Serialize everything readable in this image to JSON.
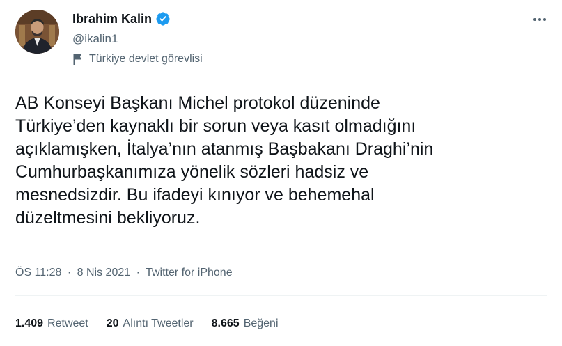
{
  "author": {
    "display_name": "Ibrahim Kalin",
    "handle": "@ikalin1",
    "label": "Türkiye devlet görevlisi",
    "verified_color": "#1d9bf0"
  },
  "tweet": {
    "text": "AB Konseyi Başkanı Michel protokol düzeninde\nTürkiye’den kaynaklı bir sorun veya kasıt olmadığını\naçıklamışken, İtalya’nın atanmış Başbakanı Draghi’nin\nCumhurbaşkanımıza yönelik sözleri hadsiz ve\nmesnedsizdir. Bu ifadeyi kınıyor ve behemehal\ndüzeltmesini bekliyoruz.",
    "time": "ÖS 11:28",
    "separator": "·",
    "date": "8 Nis 2021",
    "source": "Twitter for iPhone"
  },
  "stats": {
    "retweets": {
      "count": "1.409",
      "label": "Retweet"
    },
    "quotes": {
      "count": "20",
      "label": "Alıntı Tweetler"
    },
    "likes": {
      "count": "8.665",
      "label": "Beğeni"
    }
  },
  "icons": {
    "verified": "verified-badge-icon",
    "label": "flag-icon",
    "more": "more-options-icon"
  }
}
